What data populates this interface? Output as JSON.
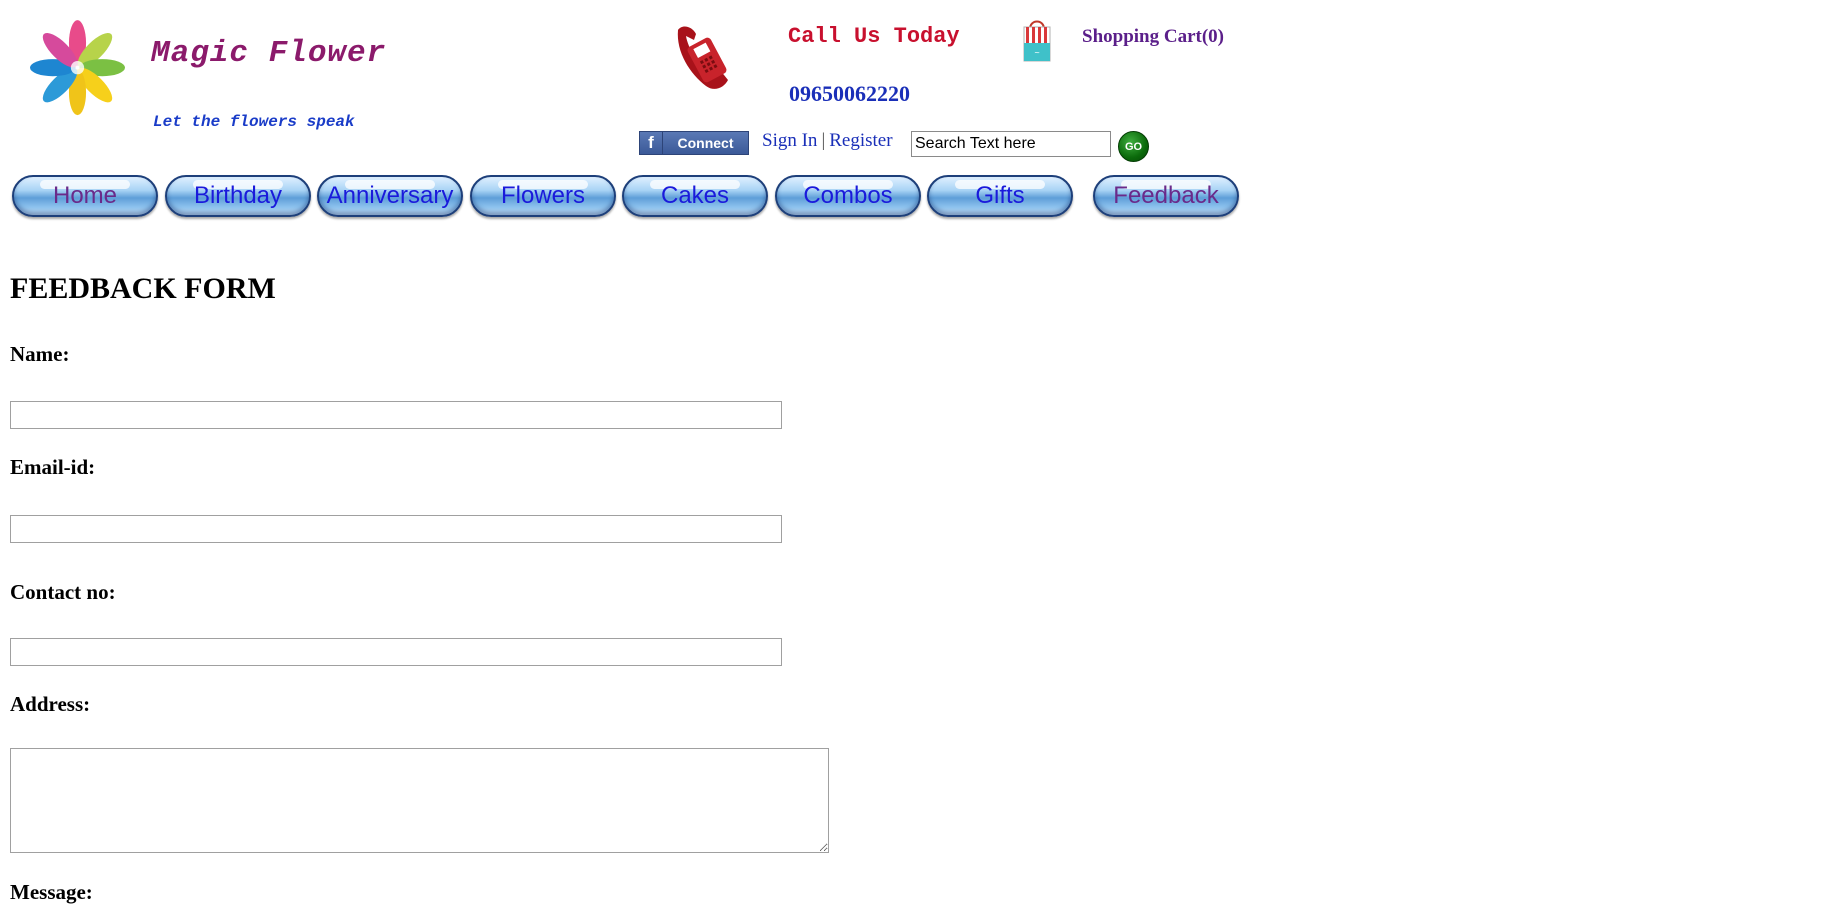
{
  "header": {
    "brand_name": "Magic Flower",
    "tagline": "Let the flowers speak",
    "call_label": "Call Us Today",
    "phone_number": "09650062220",
    "cart_label": "Shopping Cart(0)",
    "facebook_connect_label": "Connect",
    "sign_in_label": "Sign In",
    "separator": "|",
    "register_label": "Register",
    "search": {
      "value": "Search Text here"
    },
    "go_label": "GO"
  },
  "nav": {
    "items": [
      {
        "label": "Home",
        "visited": true
      },
      {
        "label": "Birthday",
        "visited": false
      },
      {
        "label": "Anniversary",
        "visited": false
      },
      {
        "label": "Flowers",
        "visited": false
      },
      {
        "label": "Cakes",
        "visited": false
      },
      {
        "label": "Combos",
        "visited": false
      },
      {
        "label": "Gifts",
        "visited": false
      },
      {
        "label": "Feedback",
        "visited": true
      }
    ]
  },
  "form": {
    "title": "FEEDBACK FORM",
    "name_label": "Name:",
    "email_label": "Email-id:",
    "contact_label": "Contact no:",
    "address_label": "Address:",
    "message_label": "Message:",
    "name_value": "",
    "email_value": "",
    "contact_value": "",
    "address_value": ""
  },
  "colors": {
    "brand": "#8b1a6b",
    "tagline": "#1a3cc8",
    "call": "#c8102e",
    "link": "#1a2fb8",
    "visited_link": "#6a2a8a",
    "nav_border": "#1d3f7a",
    "go_button": "#0b6a0b"
  },
  "icons": [
    "logo-pinwheel-icon",
    "phone-icon",
    "shopping-bag-icon",
    "facebook-icon"
  ]
}
